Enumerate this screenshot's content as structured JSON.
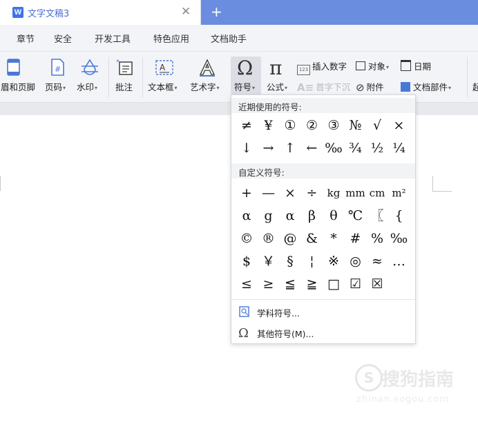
{
  "titlebar": {
    "app_logo": "W",
    "doc_title": "文字文稿3",
    "close_glyph": "✕",
    "add_glyph": "+"
  },
  "menubar": {
    "items": [
      "章节",
      "安全",
      "开发工具",
      "特色应用",
      "文档助手"
    ]
  },
  "ribbon": {
    "header_footer": "眉和页脚",
    "page_number": "页码",
    "watermark": "水印",
    "comment": "批注",
    "textbox": "文本框",
    "wordart": "艺术字",
    "symbol": "符号",
    "formula": "公式",
    "insert_number": "插入数字",
    "object": "对象",
    "date": "日期",
    "drop_cap": "首字下沉",
    "attachment": "附件",
    "doc_parts": "文档部件",
    "overflow": "起"
  },
  "symbol_panel": {
    "recent_title": "近期使用的符号:",
    "recent_symbols": [
      "≠",
      "¥",
      "①",
      "②",
      "③",
      "№",
      "√",
      "×",
      "↓",
      "→",
      "↑",
      "←",
      "‰",
      "¾",
      "½",
      "¼"
    ],
    "custom_title": "自定义符号:",
    "custom_symbols": [
      "+",
      "—",
      "×",
      "÷",
      "kg",
      "mm",
      "cm",
      "m²",
      "α",
      "g",
      "α",
      "β",
      "θ",
      "℃",
      "〖",
      "{",
      "©",
      "®",
      "@",
      "&",
      "*",
      "#",
      "%",
      "‰",
      "$",
      "￥",
      "§",
      "¦",
      "※",
      "◎",
      "≈",
      "…",
      "≤",
      "≥",
      "≦",
      "≧",
      "□",
      "☑",
      "☒"
    ],
    "subject_symbols": "学科符号...",
    "other_symbols": "其他符号(M)..."
  },
  "watermark": {
    "brand": "搜狗指南",
    "url": "zhinan.sogou.com"
  }
}
